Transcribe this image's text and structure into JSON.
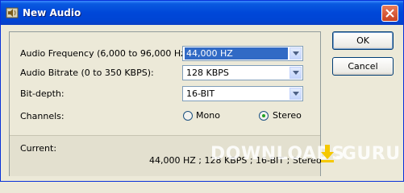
{
  "window": {
    "title": "New Audio",
    "icon": "speaker-icon",
    "close_icon": "close-icon"
  },
  "form": {
    "frequency": {
      "label": "Audio Frequency (6,000 to 96,000 Hz):",
      "value": "44,000 HZ"
    },
    "bitrate": {
      "label": "Audio Bitrate (0 to 350 KBPS):",
      "value": "128 KBPS"
    },
    "bitdepth": {
      "label": "Bit-depth:",
      "value": "16-BIT"
    },
    "channels": {
      "label": "Channels:",
      "options": [
        {
          "label": "Mono",
          "selected": false
        },
        {
          "label": "Stereo",
          "selected": true
        }
      ]
    }
  },
  "status": {
    "current_label": "Current:",
    "current_value": "44,000 HZ ; 128 KBPS ; 16-BIT ; Stereo"
  },
  "buttons": {
    "ok": "OK",
    "cancel": "Cancel"
  },
  "watermark": {
    "left": "DOWNLOADS",
    "right": ".GURU"
  },
  "colors": {
    "titlebar": "#0047d8",
    "selection": "#316ac5",
    "dialog_bg": "#ece9d8",
    "watermark_arrow": "#f5c800"
  }
}
